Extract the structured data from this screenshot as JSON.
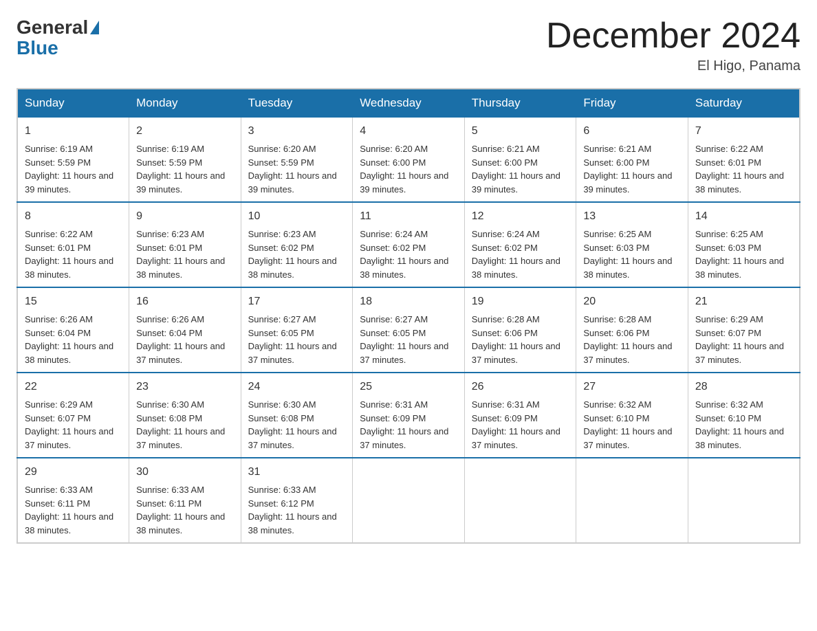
{
  "header": {
    "title": "December 2024",
    "location": "El Higo, Panama",
    "logo_general": "General",
    "logo_blue": "Blue"
  },
  "days_of_week": [
    "Sunday",
    "Monday",
    "Tuesday",
    "Wednesday",
    "Thursday",
    "Friday",
    "Saturday"
  ],
  "weeks": [
    [
      {
        "day": "1",
        "sunrise": "6:19 AM",
        "sunset": "5:59 PM",
        "daylight": "11 hours and 39 minutes."
      },
      {
        "day": "2",
        "sunrise": "6:19 AM",
        "sunset": "5:59 PM",
        "daylight": "11 hours and 39 minutes."
      },
      {
        "day": "3",
        "sunrise": "6:20 AM",
        "sunset": "5:59 PM",
        "daylight": "11 hours and 39 minutes."
      },
      {
        "day": "4",
        "sunrise": "6:20 AM",
        "sunset": "6:00 PM",
        "daylight": "11 hours and 39 minutes."
      },
      {
        "day": "5",
        "sunrise": "6:21 AM",
        "sunset": "6:00 PM",
        "daylight": "11 hours and 39 minutes."
      },
      {
        "day": "6",
        "sunrise": "6:21 AM",
        "sunset": "6:00 PM",
        "daylight": "11 hours and 39 minutes."
      },
      {
        "day": "7",
        "sunrise": "6:22 AM",
        "sunset": "6:01 PM",
        "daylight": "11 hours and 38 minutes."
      }
    ],
    [
      {
        "day": "8",
        "sunrise": "6:22 AM",
        "sunset": "6:01 PM",
        "daylight": "11 hours and 38 minutes."
      },
      {
        "day": "9",
        "sunrise": "6:23 AM",
        "sunset": "6:01 PM",
        "daylight": "11 hours and 38 minutes."
      },
      {
        "day": "10",
        "sunrise": "6:23 AM",
        "sunset": "6:02 PM",
        "daylight": "11 hours and 38 minutes."
      },
      {
        "day": "11",
        "sunrise": "6:24 AM",
        "sunset": "6:02 PM",
        "daylight": "11 hours and 38 minutes."
      },
      {
        "day": "12",
        "sunrise": "6:24 AM",
        "sunset": "6:02 PM",
        "daylight": "11 hours and 38 minutes."
      },
      {
        "day": "13",
        "sunrise": "6:25 AM",
        "sunset": "6:03 PM",
        "daylight": "11 hours and 38 minutes."
      },
      {
        "day": "14",
        "sunrise": "6:25 AM",
        "sunset": "6:03 PM",
        "daylight": "11 hours and 38 minutes."
      }
    ],
    [
      {
        "day": "15",
        "sunrise": "6:26 AM",
        "sunset": "6:04 PM",
        "daylight": "11 hours and 38 minutes."
      },
      {
        "day": "16",
        "sunrise": "6:26 AM",
        "sunset": "6:04 PM",
        "daylight": "11 hours and 37 minutes."
      },
      {
        "day": "17",
        "sunrise": "6:27 AM",
        "sunset": "6:05 PM",
        "daylight": "11 hours and 37 minutes."
      },
      {
        "day": "18",
        "sunrise": "6:27 AM",
        "sunset": "6:05 PM",
        "daylight": "11 hours and 37 minutes."
      },
      {
        "day": "19",
        "sunrise": "6:28 AM",
        "sunset": "6:06 PM",
        "daylight": "11 hours and 37 minutes."
      },
      {
        "day": "20",
        "sunrise": "6:28 AM",
        "sunset": "6:06 PM",
        "daylight": "11 hours and 37 minutes."
      },
      {
        "day": "21",
        "sunrise": "6:29 AM",
        "sunset": "6:07 PM",
        "daylight": "11 hours and 37 minutes."
      }
    ],
    [
      {
        "day": "22",
        "sunrise": "6:29 AM",
        "sunset": "6:07 PM",
        "daylight": "11 hours and 37 minutes."
      },
      {
        "day": "23",
        "sunrise": "6:30 AM",
        "sunset": "6:08 PM",
        "daylight": "11 hours and 37 minutes."
      },
      {
        "day": "24",
        "sunrise": "6:30 AM",
        "sunset": "6:08 PM",
        "daylight": "11 hours and 37 minutes."
      },
      {
        "day": "25",
        "sunrise": "6:31 AM",
        "sunset": "6:09 PM",
        "daylight": "11 hours and 37 minutes."
      },
      {
        "day": "26",
        "sunrise": "6:31 AM",
        "sunset": "6:09 PM",
        "daylight": "11 hours and 37 minutes."
      },
      {
        "day": "27",
        "sunrise": "6:32 AM",
        "sunset": "6:10 PM",
        "daylight": "11 hours and 37 minutes."
      },
      {
        "day": "28",
        "sunrise": "6:32 AM",
        "sunset": "6:10 PM",
        "daylight": "11 hours and 38 minutes."
      }
    ],
    [
      {
        "day": "29",
        "sunrise": "6:33 AM",
        "sunset": "6:11 PM",
        "daylight": "11 hours and 38 minutes."
      },
      {
        "day": "30",
        "sunrise": "6:33 AM",
        "sunset": "6:11 PM",
        "daylight": "11 hours and 38 minutes."
      },
      {
        "day": "31",
        "sunrise": "6:33 AM",
        "sunset": "6:12 PM",
        "daylight": "11 hours and 38 minutes."
      },
      null,
      null,
      null,
      null
    ]
  ],
  "labels": {
    "sunrise": "Sunrise:",
    "sunset": "Sunset:",
    "daylight": "Daylight:"
  }
}
